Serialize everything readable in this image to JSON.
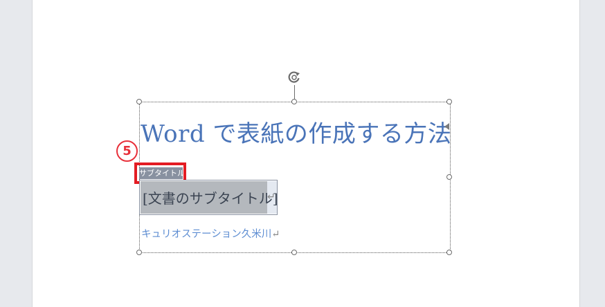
{
  "document": {
    "title": "Word で表紙の作成する方法",
    "content_control_tag": "サブタイトル",
    "subtitle_placeholder": "[文書のサブタイトル]",
    "author": "キュリオステーション久米川",
    "paragraph_mark": "↵"
  },
  "annotation": {
    "step_number": "5",
    "highlight_color": "#e31c23"
  },
  "colors": {
    "title_text": "#4a74b8",
    "author_text": "#5d8dd2",
    "tag_background": "#8891a0",
    "placeholder_highlight": "#b4b8bd"
  },
  "icons": {
    "rotate": "rotate-handle-icon",
    "resize": "resize-handle-icon",
    "anchor": "text-anchor-icon"
  }
}
